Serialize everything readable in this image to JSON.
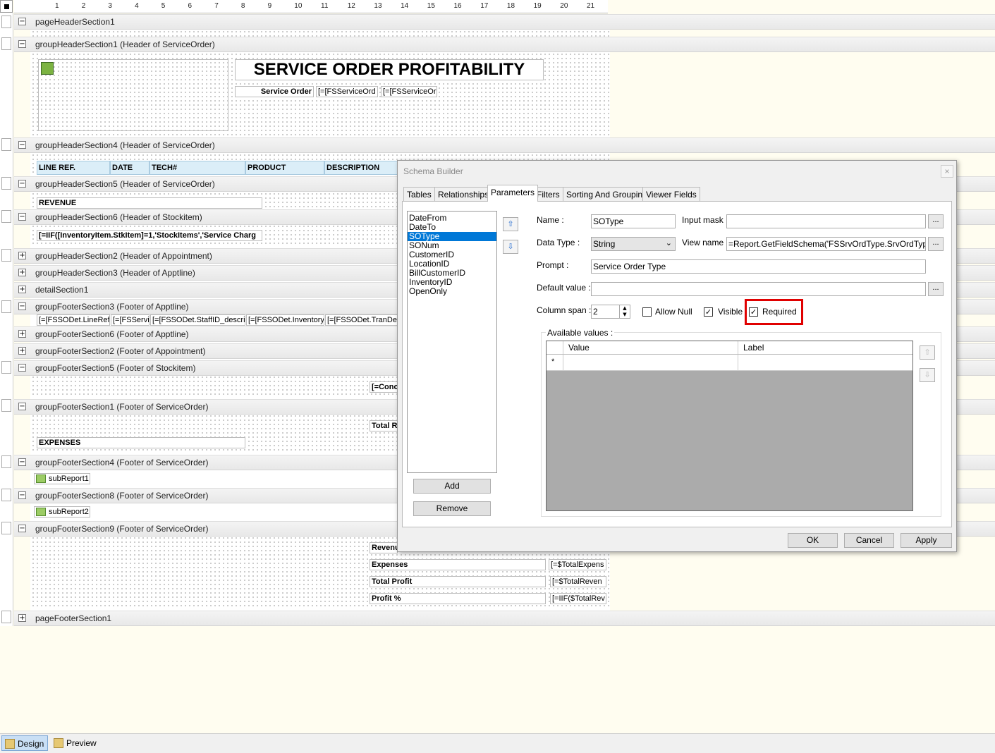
{
  "ruler": {
    "numbers": [
      "1",
      "2",
      "3",
      "4",
      "5",
      "6",
      "7",
      "8",
      "9",
      "10",
      "11",
      "12",
      "13",
      "14",
      "15",
      "16",
      "17",
      "18",
      "19",
      "20",
      "21"
    ]
  },
  "sections": {
    "pageHeader": "pageHeaderSection1",
    "groupHeader1": "groupHeaderSection1 (Header of ServiceOrder)",
    "groupHeader4": "groupHeaderSection4 (Header of ServiceOrder)",
    "groupHeader5": "groupHeaderSection5 (Header of ServiceOrder)",
    "groupHeader6": "groupHeaderSection6 (Header of Stockitem)",
    "groupHeader2": "groupHeaderSection2 (Header of Appointment)",
    "groupHeader3": "groupHeaderSection3 (Header of Apptline)",
    "detail": "detailSection1",
    "groupFooter3": "groupFooterSection3 (Footer of Apptline)",
    "groupFooter6": "groupFooterSection6 (Footer of Apptline)",
    "groupFooter2": "groupFooterSection2 (Footer of Appointment)",
    "groupFooter5": "groupFooterSection5 (Footer of Stockitem)",
    "groupFooter1": "groupFooterSection1 (Footer of ServiceOrder)",
    "groupFooter4": "groupFooterSection4 (Footer of ServiceOrder)",
    "groupFooter8": "groupFooterSection8 (Footer of ServiceOrder)",
    "groupFooter9": "groupFooterSection9 (Footer of ServiceOrder)",
    "pageFooter": "pageFooterSection1",
    "toggle_minus": "−",
    "toggle_plus": "+"
  },
  "report": {
    "title": "SERVICE ORDER PROFITABILITY",
    "service_order_label": "Service Order",
    "service_order_field1": "[=[FSServiceOrd",
    "service_order_field2": "[=[FSServiceOr",
    "columns": [
      "LINE REF.",
      "DATE",
      "TECH#",
      "PRODUCT",
      "DESCRIPTION"
    ],
    "revenue": "REVENUE",
    "stock_expr": "[=IIF([InventoryItem.StkItem]=1,'StockItems','Service Charg",
    "detail_fields": [
      "[=[FSSODet.LineRef",
      "[=[FSServi",
      "[=[FSSODet.StaffID_descri",
      "[=[FSSODet.Inventory",
      "[=[FSSODet.TranDes"
    ],
    "conc_field": "[=Conc",
    "total_r": "Total R",
    "expenses": "EXPENSES",
    "subreport1": "subReport1",
    "subreport2": "subReport2",
    "summary": {
      "revenue": "Revenu",
      "expenses": "Expenses",
      "total_profit": "Total Profit",
      "profit_pct": "Profit %",
      "expenses_val": "[=$TotalExpens",
      "total_profit_val": "[=$TotalReven",
      "profit_pct_val": "[=IIF($TotalRev"
    }
  },
  "dialog": {
    "title": "Schema Builder",
    "close": "×",
    "tabs": [
      "Tables",
      "Relationships",
      "Parameters",
      "Filters",
      "Sorting And Grouping",
      "Viewer Fields"
    ],
    "params": [
      "DateFrom",
      "DateTo",
      "SOType",
      "SONum",
      "CustomerID",
      "LocationID",
      "BillCustomerID",
      "InventoryID",
      "OpenOnly"
    ],
    "selected_param": "SOType",
    "up_arrow": "⇧",
    "down_arrow": "⇩",
    "add": "Add",
    "remove": "Remove",
    "name_label": "Name :",
    "name_value": "SOType",
    "input_mask_label": "Input mask :",
    "input_mask_value": "",
    "data_type_label": "Data Type :",
    "data_type_value": "String",
    "view_name_label": "View name :",
    "view_name_value": "=Report.GetFieldSchema('FSSrvOrdType.SrvOrdType')",
    "prompt_label": "Prompt :",
    "prompt_value": "Service Order Type",
    "default_label": "Default value :",
    "default_value": "",
    "colspan_label": "Column span :",
    "colspan_value": "2",
    "allow_null": "Allow Null",
    "visible": "Visible",
    "required": "Required",
    "available_values": "Available values :",
    "col_value": "Value",
    "col_label": "Label",
    "newrow_marker": "*",
    "ellipsis": "...",
    "ok": "OK",
    "cancel": "Cancel",
    "apply": "Apply",
    "checkmark": "✓",
    "highlight_color": "#e00000"
  },
  "bottom_tabs": {
    "design": "Design",
    "preview": "Preview"
  }
}
